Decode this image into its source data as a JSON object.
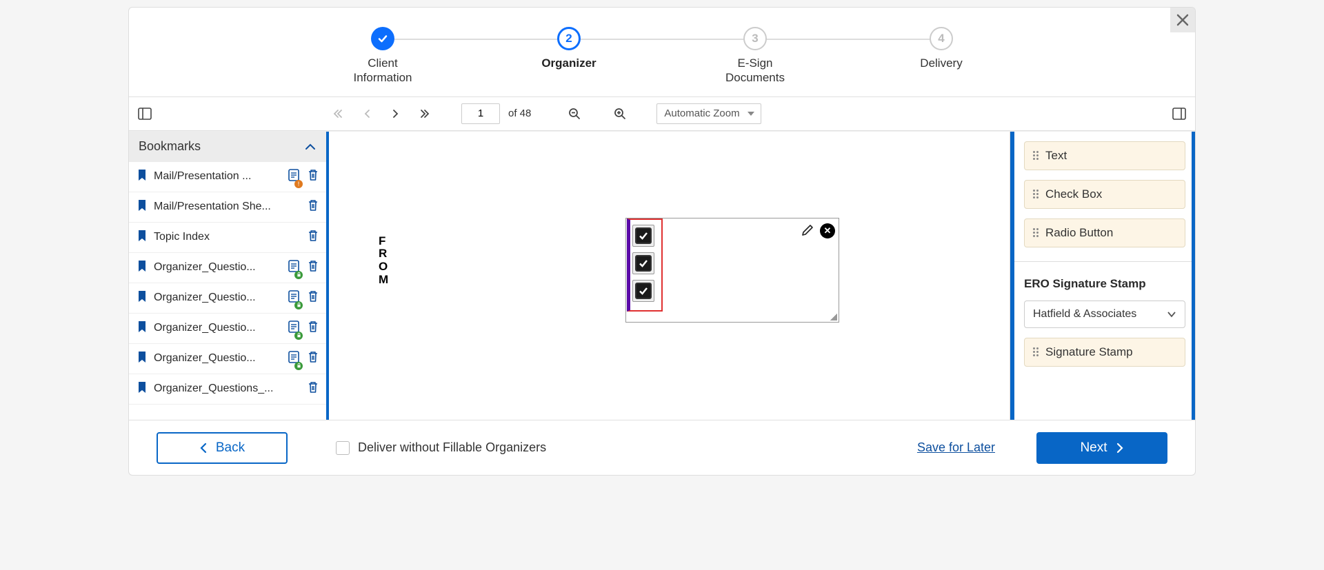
{
  "stepper": {
    "steps": [
      {
        "num": "✓",
        "label": "Client\nInformation",
        "state": "complete"
      },
      {
        "num": "2",
        "label": "Organizer",
        "state": "active"
      },
      {
        "num": "3",
        "label": "E-Sign\nDocuments",
        "state": "pending"
      },
      {
        "num": "4",
        "label": "Delivery",
        "state": "pending"
      }
    ]
  },
  "toolbar": {
    "page_current": "1",
    "page_of": "of 48",
    "zoom": "Automatic Zoom"
  },
  "bookmarks": {
    "title": "Bookmarks",
    "items": [
      {
        "label": "Mail/Presentation ...",
        "has_doc": true,
        "badge": "alert",
        "trash": true
      },
      {
        "label": "Mail/Presentation She...",
        "has_doc": false,
        "trash": true
      },
      {
        "label": "Topic Index",
        "has_doc": false,
        "trash": true
      },
      {
        "label": "Organizer_Questio...",
        "has_doc": true,
        "badge": "lock",
        "trash": true
      },
      {
        "label": "Organizer_Questio...",
        "has_doc": true,
        "badge": "lock",
        "trash": true
      },
      {
        "label": "Organizer_Questio...",
        "has_doc": true,
        "badge": "lock",
        "trash": true
      },
      {
        "label": "Organizer_Questio...",
        "has_doc": true,
        "badge": "lock",
        "trash": true
      },
      {
        "label": "Organizer_Questions_...",
        "has_doc": false,
        "trash": true
      }
    ]
  },
  "viewer": {
    "from_label": "FROM"
  },
  "right_panel": {
    "fields": [
      "Text",
      "Check Box",
      "Radio Button"
    ],
    "stamp_title": "ERO Signature Stamp",
    "stamp_selected": "Hatfield & Associates",
    "stamp_button": "Signature Stamp"
  },
  "footer": {
    "back": "Back",
    "deliver_label": "Deliver without Fillable Organizers",
    "save_later": "Save for Later",
    "next": "Next"
  }
}
